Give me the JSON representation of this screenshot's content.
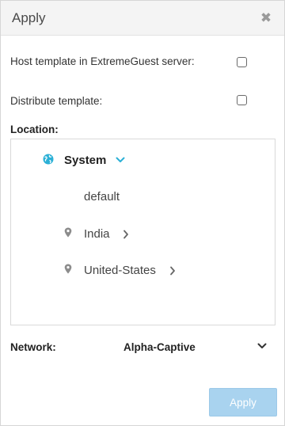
{
  "dialog": {
    "title": "Apply",
    "close_icon": "close-icon"
  },
  "options": {
    "host_template": {
      "label": "Host template in ExtremeGuest server:",
      "checked": false
    },
    "distribute_template": {
      "label": "Distribute template:",
      "checked": false
    }
  },
  "location": {
    "label": "Location:",
    "root": {
      "name": "System",
      "icon": "globe-icon",
      "expanded": true
    },
    "children": [
      {
        "name": "default",
        "icon": ""
      },
      {
        "name": "India",
        "icon": "map-pin-icon"
      },
      {
        "name": "United-States",
        "icon": "map-pin-icon"
      }
    ]
  },
  "network": {
    "label": "Network:",
    "value": "Alpha-Captive"
  },
  "footer": {
    "apply_label": "Apply"
  },
  "colors": {
    "accent": "#2bb0d6",
    "button_disabled": "#a9d3ef",
    "header_bg": "#f4f4f4"
  }
}
